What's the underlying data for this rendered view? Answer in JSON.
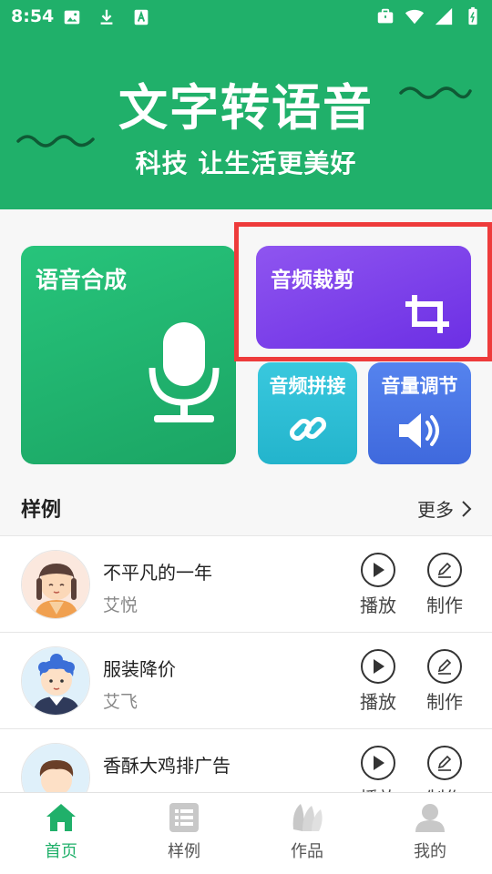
{
  "status_bar": {
    "time": "8:54"
  },
  "hero": {
    "title": "文字转语音",
    "subtitle": "科技 让生活更美好"
  },
  "cards": {
    "tts": "语音合成",
    "crop": "音频裁剪",
    "join": "音频拼接",
    "volume": "音量调节"
  },
  "samples": {
    "title": "样例",
    "more": "更多",
    "items": [
      {
        "title": "不平凡的一年",
        "author": "艾悦",
        "play": "播放",
        "make": "制作"
      },
      {
        "title": "服装降价",
        "author": "艾飞",
        "play": "播放",
        "make": "制作"
      },
      {
        "title": "香酥大鸡排广告",
        "author": "",
        "play": "播放",
        "make": "制作"
      }
    ]
  },
  "nav": {
    "home": "首页",
    "sample": "样例",
    "works": "作品",
    "mine": "我的",
    "active_color": "#20b06a"
  },
  "colors": {
    "brand_green": "#20b06a",
    "highlight": "#ee3b3b"
  }
}
